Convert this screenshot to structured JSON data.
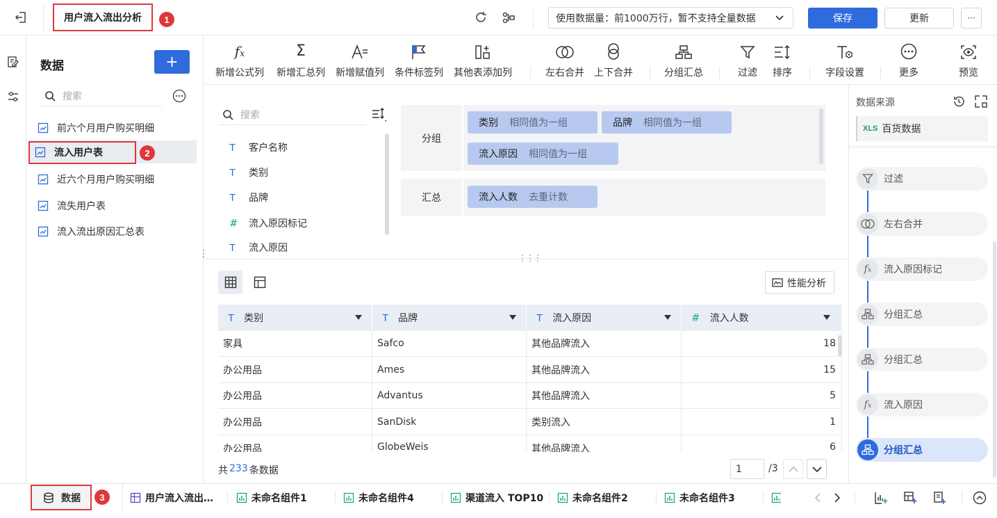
{
  "header": {
    "title": "用户流入流出分析",
    "badge1": "1",
    "data_volume": "使用数据量：前1000万行，暂不支持全量数据",
    "save_label": "保存",
    "update_label": "更新",
    "more_label": "···"
  },
  "data_panel": {
    "title": "数据",
    "add_label": "+",
    "search_placeholder": "搜索",
    "items": [
      {
        "label": "前六个月用户购买明细"
      },
      {
        "label": "流入用户表"
      },
      {
        "label": "近六个月用户购买明细"
      },
      {
        "label": "流失用户表"
      },
      {
        "label": "流入流出原因汇总表"
      }
    ],
    "badge2": "2"
  },
  "toolbar": {
    "items": [
      {
        "label": "新增公式列",
        "icon": "fx-icon"
      },
      {
        "label": "新增汇总列",
        "icon": "sigma-icon"
      },
      {
        "label": "新增赋值列",
        "icon": "assign-icon"
      },
      {
        "label": "条件标签列",
        "icon": "flag-icon"
      },
      {
        "label": "其他表添加列",
        "icon": "add-column-icon"
      },
      {
        "label": "左右合并",
        "icon": "lr-merge-icon"
      },
      {
        "label": "上下合并",
        "icon": "ud-merge-icon"
      },
      {
        "label": "分组汇总",
        "icon": "group-icon"
      },
      {
        "label": "过滤",
        "icon": "filter-icon"
      },
      {
        "label": "排序",
        "icon": "sort-icon"
      },
      {
        "label": "字段设置",
        "icon": "field-setting-icon"
      },
      {
        "label": "更多",
        "icon": "more-icon"
      },
      {
        "label": "预览",
        "icon": "preview-icon"
      }
    ]
  },
  "fields": {
    "search_placeholder": "搜索",
    "items": [
      {
        "name": "客户名称",
        "type": "T"
      },
      {
        "name": "类别",
        "type": "T"
      },
      {
        "name": "品牌",
        "type": "T"
      },
      {
        "name": "流入原因标记",
        "type": "#"
      },
      {
        "name": "流入原因",
        "type": "T"
      }
    ]
  },
  "config": {
    "group_label": "分组",
    "summary_label": "汇总",
    "group_chips": [
      {
        "name": "类别",
        "value": "相同值为一组"
      },
      {
        "name": "品牌",
        "value": "相同值为一组"
      },
      {
        "name": "流入原因",
        "value": "相同值为一组"
      }
    ],
    "summary_chips": [
      {
        "name": "流入人数",
        "value": "去重计数"
      }
    ]
  },
  "table": {
    "perf_label": "性能分析",
    "headers": [
      {
        "label": "类别",
        "type": "T"
      },
      {
        "label": "品牌",
        "type": "T"
      },
      {
        "label": "流入原因",
        "type": "T"
      },
      {
        "label": "流入人数",
        "type": "#"
      }
    ],
    "rows": [
      [
        "家具",
        "Safco",
        "其他品牌流入",
        "18"
      ],
      [
        "办公用品",
        "Ames",
        "其他品牌流入",
        "15"
      ],
      [
        "办公用品",
        "Advantus",
        "其他品牌流入",
        "5"
      ],
      [
        "办公用品",
        "SanDisk",
        "类别流入",
        "1"
      ],
      [
        "办公用品",
        "GlobeWeis",
        "其他品牌流入",
        "6"
      ]
    ],
    "footer_prefix": "共",
    "footer_count": "233",
    "footer_suffix": "条数据",
    "page_value": "1",
    "page_total": "/3"
  },
  "right_panel": {
    "title": "数据来源",
    "source_name": "百货数据",
    "source_icon": "XLS",
    "steps": [
      {
        "label": "过滤",
        "icon": "filter-icon"
      },
      {
        "label": "左右合并",
        "icon": "lr-merge-icon"
      },
      {
        "label": "流入原因标记",
        "icon": "fx-icon"
      },
      {
        "label": "分组汇总",
        "icon": "group-icon"
      },
      {
        "label": "分组汇总",
        "icon": "group-icon"
      },
      {
        "label": "流入原因",
        "icon": "fx-icon"
      },
      {
        "label": "分组汇总",
        "icon": "group-icon"
      }
    ]
  },
  "bottom_bar": {
    "data_tab": "数据",
    "badge3": "3",
    "tabs": [
      {
        "label": "用户流入流出…"
      },
      {
        "label": "未命名组件1"
      },
      {
        "label": "未命名组件4"
      },
      {
        "label": "渠道流入 TOP10"
      },
      {
        "label": "未命名组件2"
      },
      {
        "label": "未命名组件3"
      }
    ]
  },
  "colors": {
    "primary": "#2f6bdc",
    "accent_red": "#e0373b",
    "chip_bg": "#b7c9ef",
    "active_step_bg": "#dbe6fb",
    "xls_green": "#1f9d55"
  }
}
